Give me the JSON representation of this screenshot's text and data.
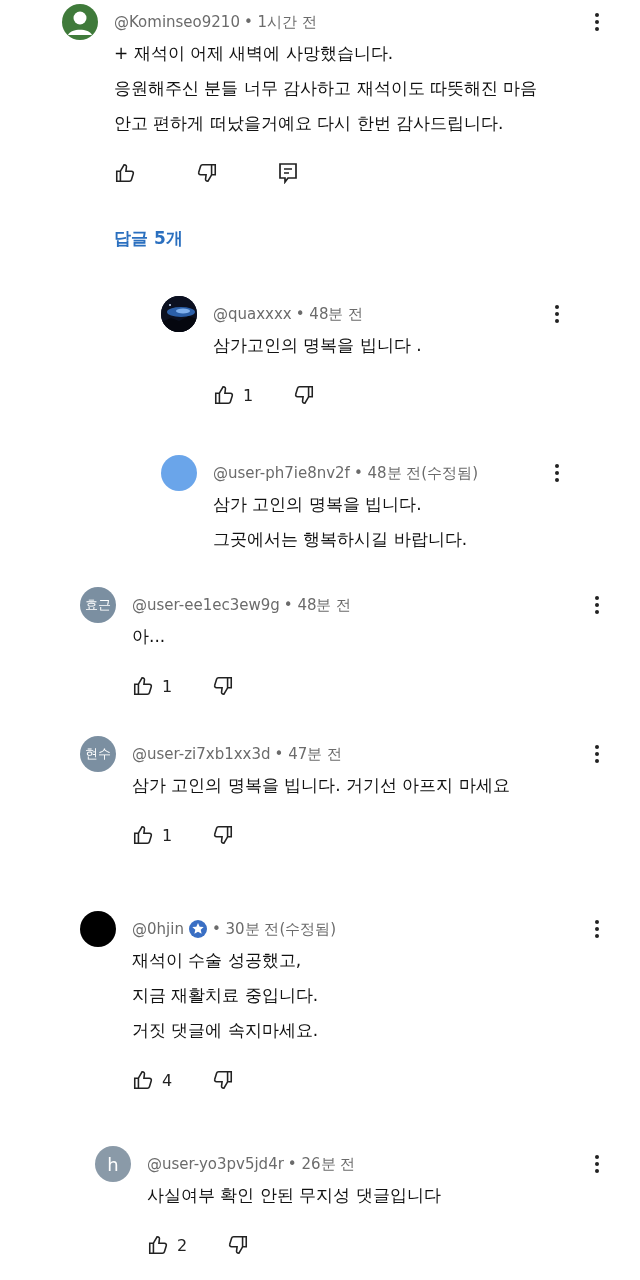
{
  "comments": [
    {
      "avatar": {
        "kind": "person",
        "color": "#3f7a3a"
      },
      "author": "@Kominseo9210",
      "time": "• 1시간 전",
      "verified": false,
      "lines": [
        "+ 재석이 어제 새벽에 사망했습니다.",
        "응원해주신 분들 너무 감사하고 재석이도 따뜻해진 마음",
        "안고 편하게 떠났을거예요 다시 한번 감사드립니다."
      ],
      "actions": {
        "reply_button": true
      },
      "replies_label": "답글 5개",
      "children": [
        {
          "avatar": {
            "kind": "picture"
          },
          "author": "@quaxxxx",
          "time": "• 48분 전",
          "verified": false,
          "lines": [
            "삼가고인의 명복을 빕니다 ."
          ],
          "actions": {
            "likes": "1",
            "reply_button": false
          }
        },
        {
          "avatar": {
            "kind": "plain",
            "color": "#6aa5ea"
          },
          "author": "@user-ph7ie8nv2f",
          "time": "• 48분 전(수정됨)",
          "verified": false,
          "lines": [
            "삼가 고인의 명복을 빕니다.",
            "그곳에서는 행복하시길 바랍니다."
          ]
        }
      ]
    },
    {
      "avatar": {
        "kind": "initials",
        "text": "효근",
        "color": "#7b8fa1"
      },
      "author": "@user-ee1ec3ew9g",
      "time": "• 48분 전",
      "verified": false,
      "lines": [
        "아..."
      ],
      "actions": {
        "likes": "1",
        "reply_button": false
      }
    },
    {
      "avatar": {
        "kind": "initials",
        "text": "현수",
        "color": "#7b8fa1"
      },
      "author": "@user-zi7xb1xx3d",
      "time": "• 47분 전",
      "verified": false,
      "lines": [
        "삼가 고인의 명복을 빕니다. 거기선 아프지 마세요"
      ],
      "actions": {
        "likes": "1",
        "reply_button": false
      }
    },
    {
      "avatar": {
        "kind": "plain",
        "color": "#000000"
      },
      "author": "@0hjin",
      "time": "• 30분 전(수정됨)",
      "verified": true,
      "lines": [
        "재석이 수술 성공했고,",
        "지금 재활치료 중입니다.",
        "거짓 댓글에 속지마세요."
      ],
      "actions": {
        "likes": "4",
        "reply_button": false
      }
    },
    {
      "avatar": {
        "kind": "initials",
        "text": "h",
        "color": "#8a9aa8"
      },
      "author": "@user-yo3pv5jd4r",
      "time": "• 26분 전",
      "verified": false,
      "lines": [
        "사실여부 확인 안된 무지성 댓글입니다"
      ],
      "actions": {
        "likes": "2",
        "reply_button": false
      }
    }
  ]
}
